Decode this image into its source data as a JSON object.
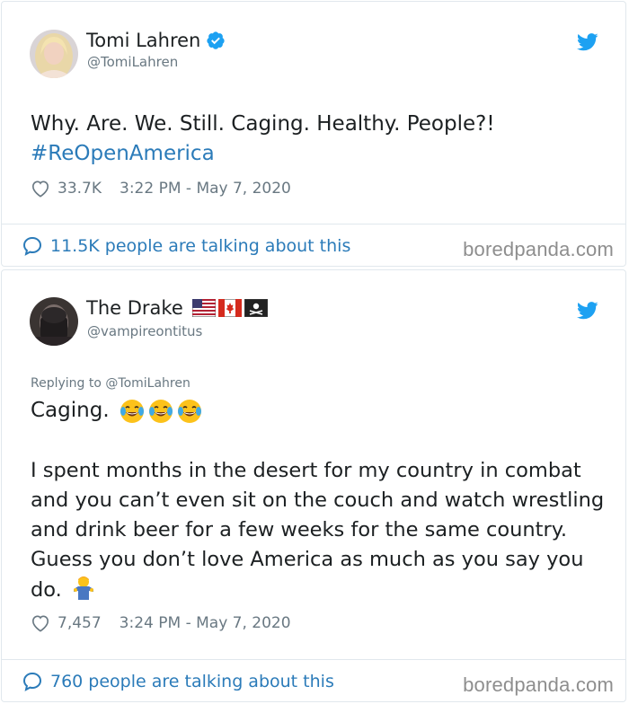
{
  "tweet1": {
    "display_name": "Tomi Lahren",
    "handle": "@TomiLahren",
    "verified": true,
    "text": "Why. Are. We. Still. Caging. Healthy. People?!",
    "hashtag": "#ReOpenAmerica",
    "likes": "33.7K",
    "timestamp": "3:22 PM - May 7, 2020",
    "talking": "11.5K people are talking about this",
    "watermark": "boredpanda.com"
  },
  "tweet2": {
    "display_name": "The Drake",
    "handle": "@vampireontitus",
    "flags": [
      "us-flag-icon",
      "canada-flag-icon",
      "pirate-flag-icon"
    ],
    "replying_prefix": "Replying to ",
    "replying_handle": "@TomiLahren",
    "line1": "Caging.",
    "line1_emoji_count": 3,
    "paragraph": "I spent months in the desert for my country in combat and you can’t even sit on the couch and watch wrestling and drink beer for a few weeks for the same country. Guess you don’t love America as much as you say you do.",
    "likes": "7,457",
    "timestamp": "3:24 PM - May 7, 2020",
    "talking": "760 people are talking about this",
    "watermark": "boredpanda.com"
  },
  "colors": {
    "link_blue": "#2b7bb9",
    "twitter_blue": "#1da1f2",
    "muted_gray": "#697882",
    "border": "#e1e8ed",
    "text": "#1c2022",
    "watermark": "#8e8e8e"
  }
}
